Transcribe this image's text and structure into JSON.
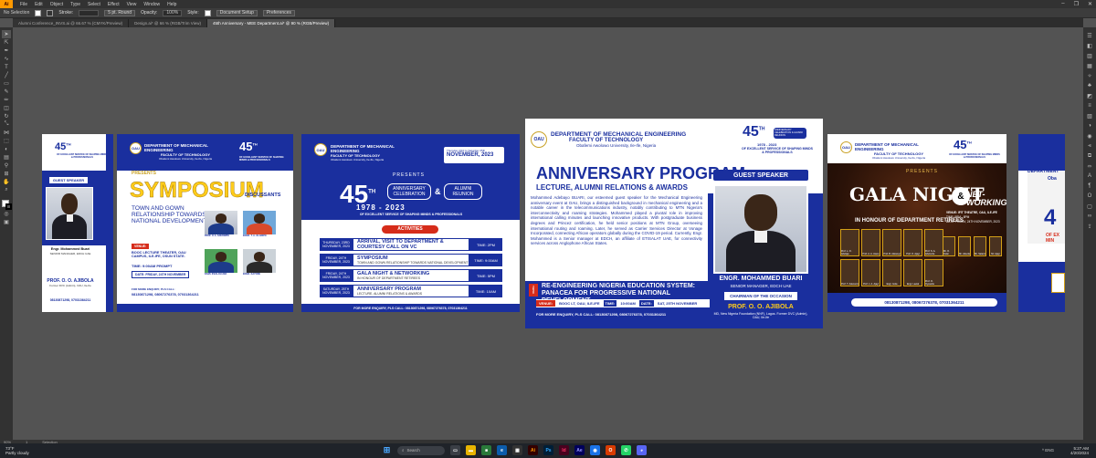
{
  "app": {
    "logo": "Ai",
    "menu": [
      "File",
      "Edit",
      "Object",
      "Type",
      "Select",
      "Effect",
      "View",
      "Window",
      "Help"
    ],
    "layout_icon": "grid-layout-icon"
  },
  "control": {
    "selection": "No Selection",
    "stroke_label": "Stroke:",
    "style_btn": "5 pt. Round",
    "opacity_label": "Opacity:",
    "opacity_value": "100%",
    "style_label": "Style:",
    "doc_setup": "Document Setup",
    "preferences": "Preferences"
  },
  "tabs": [
    "Alumni Conference_INVS.ai @ 66.67 % (CMYK/Preview)",
    "Design.ai* @ 66 % (RGB/Trim View)",
    "45th Anniversary - MEE Department.ai* @ 90 % (RGB/Preview)"
  ],
  "active_tab": 2,
  "status": {
    "zoom": "90%",
    "page": "1",
    "label": "Selection"
  },
  "taskbar": {
    "temp": "73°F",
    "weather": "Partly cloudy",
    "search": "Search",
    "time": "5:27 AM",
    "date": "4/20/2024",
    "tray": "^  ENG"
  },
  "dept": "DEPARTMENT OF MECHANICAL ENGINEERING",
  "faculty": "FACULTY OF TECHNOLOGY",
  "university": "Obafemi Awolowo University, Ile-Ife, Nigeria",
  "years": "1978 - 2023",
  "anniv_sub": "OF EXCELLENT SERVICE OF SHAPING MINDS & PROFESSIONALS",
  "badge_45": "45",
  "badge_th": "TH",
  "badge_right": "ANNIVERSARY CELEBRATION & ALUMNI REUNION",
  "ab1": {
    "guest": "GUEST SPEAKER",
    "name": "Engr. Mohammed Buari",
    "role": "SENIOR MANAGER, EDCH UAE",
    "chair": "PROF. O. O. AJIBOLA",
    "chair_role": "Former DVC (Admin), OAU, Ile-Ife",
    "phone": "08130871298, 07031364211"
  },
  "ab2": {
    "presents": "PRESENTS",
    "title": "SYMPOSIUM",
    "theme": "TOWN AND GOWN RELATIONSHIP TOWARDS NATIONAL DEVELOPMENT",
    "discussants": "DISCUSSANTS",
    "venue_label": "VENUE:",
    "venue": "BOOC LECTURE THEATER, OAU CAMPUS, ILE-IFE, OSUN STATE.",
    "time": "TIME: 9:00AM PROMPT",
    "date": "DATE: FRIDAY, 24TH NOVEMBER",
    "enquiry": "FOR MORE ENQUIRY, PLS CALL:",
    "phones": "08130871298, 08067276378, 07031364211",
    "people": [
      "PROF. O.A. ADEBIMPE",
      "ENGR. T. A. OLADIPO",
      "DAMI. IFEALOLUWA",
      "ENGR. KAYODE"
    ]
  },
  "ab3": {
    "date_badge": "Thursday 23rd to Saturday 25th",
    "month": "NOVEMBER, 2023",
    "presents": "PRESENTS",
    "anniv": "ANNIVERSARY CELEBRATION",
    "reunion": "ALUMNI REUNION",
    "activities": "ACTIVITIES",
    "events": [
      {
        "date": "THURSDAY, 23RD NOVEMBER, 2023",
        "title": "ARRIVAL, VISIT TO DEPARTMENT & COURTESY CALL ON VC",
        "time": "TIME: 2PM"
      },
      {
        "date": "FRIDAY, 24TH NOVEMBER, 2023",
        "title": "SYMPOSIUM",
        "sub": "TOWN AND GOWN RELATIONSHIP TOWARDS NATIONAL DEVELOPMENT",
        "time": "TIME: 9:00AM"
      },
      {
        "date": "FRIDAY, 24TH NOVEMBER, 2023",
        "title": "GALA NIGHT & NETWORKING",
        "sub": "IN HONOUR OF DEPARTMENT RETIREES",
        "time": "TIME: 5PM"
      },
      {
        "date": "SATURDAY, 25TH NOVEMBER, 2023",
        "title": "ANNIVERSARY PROGRAM",
        "sub": "LECTURE, ALUMNI RELATIONS & AWARDS",
        "time": "TIME: 10AM"
      }
    ],
    "enquiry": "FOR MORE ENQUIRY, PLS CALL: 08130871298, 08067276378, 07031364211"
  },
  "ab4": {
    "title": "ANNIVERSARY PROGRAM",
    "subtitle": "LECTURE, ALUMNI RELATIONS & AWARDS",
    "guest": "GUEST SPEAKER",
    "bio": "Mohammed Adebayo BUARI, our esteemed guest speaker for the Mechanical Engineering anniversary event at OAU, brings a distinguished background in mechanical engineering and a notable career in the telecommunications industry, notably contributing to MTN Nigeria's interconnectivity and roaming strategies. Mohammed played a pivotal role in improving international calling minutes and launching innovative products. With postgraduate business degrees and Prince2 certification, he held senior positions at MTN Group, overseeing international routing and roaming. Later, he served as Carrier Services Director at Vonage Incorporated, connecting African operators globally during the COVID-19 period. Currently, Engr. Mohammed is a Senior manager at EDCH, an affiliate of ETISALAT UAE, for connectivity services across Anglophone African States.",
    "topic_tag": "TOPIC",
    "topic": "RE-ENGINEERING NIGERIA EDUCATION SYSTEM: PANACEA FOR PROGRESSIVE NATIONAL DEVELOPMENT",
    "venue": "VENUE:",
    "venue_val": "BOOC LT, OAU, ILE-IFE",
    "time_label": "TIME:",
    "time_val": "10:00AM",
    "date_label": "DATE:",
    "date_val": "SAT, 25TH NOVEMBER",
    "enquiry": "FOR MORE ENQUIRY, PLS CALL: 08130871298, 08067276378, 07031364211",
    "speaker_name": "ENGR. MOHAMMED BUARI",
    "speaker_role": "SENIOR MANAGER, EDCH UAE",
    "chair_label": "CHAIRMAN OF THE OCCASION",
    "chair": "PROF. O. O. AJIBOLA",
    "chair_role": "MD, New Nigeria Foundation (NNF), Lagos. Former DVC (Admin), OAU, Ile-Ife"
  },
  "ab5": {
    "presents": "PRESENTS",
    "gala": "GALA NIGHT",
    "net": "NET- WORKING",
    "honour": "IN HONOUR OF DEPARTMENT RETIREES",
    "venue": "VENUE: IFIT THEATRE, OAU, ILE-IFE",
    "time": "TIME: 5PM - 8PM",
    "date": "DATE: FRIDAY, 24TH NOVEMBER, 2023",
    "phones": "08130871298, 08067276378, 07031364211",
    "honorees": [
      "Prof. L. O. Adelaja",
      "Prof. A. A. Asere",
      "Prof. B. Adewuyi",
      "Prof. O. Ajayi",
      "Prof. S. A. Adekunle",
      "Prof. T. Adewumi",
      "Prof. J. A. Ajayi",
      "Engr. Isola",
      "Engr. Lawal",
      "Prof. O. Oyewola",
      "Mr. O. Fatai",
      "Mr. Adeola",
      "Mr. Salami",
      "Mr. Ajayi"
    ]
  },
  "ab6": {
    "dept": "DEPARTMENT",
    "uni": "Oba",
    "big": "4",
    "sub": "OF EX MIN"
  }
}
